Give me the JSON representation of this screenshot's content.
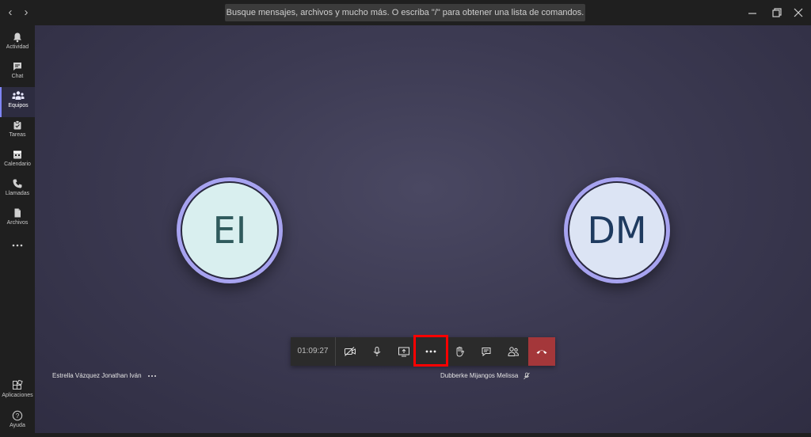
{
  "search": {
    "placeholder": "Busque mensajes, archivos y mucho más. O escriba \"/\" para obtener una lista de comandos."
  },
  "nav": {
    "back": "‹",
    "forward": "›"
  },
  "rail": {
    "items": [
      {
        "label": "Actividad",
        "icon": "bell-icon"
      },
      {
        "label": "Chat",
        "icon": "chat-icon"
      },
      {
        "label": "Equipos",
        "icon": "teams-icon",
        "active": true
      },
      {
        "label": "Tareas",
        "icon": "tasks-icon"
      },
      {
        "label": "Calendario",
        "icon": "calendar-icon"
      },
      {
        "label": "Llamadas",
        "icon": "phone-icon"
      },
      {
        "label": "Archivos",
        "icon": "files-icon"
      },
      {
        "label": "Más",
        "icon": "more-icon"
      }
    ],
    "bottom": [
      {
        "label": "Aplicaciones",
        "icon": "apps-icon"
      },
      {
        "label": "Ayuda",
        "icon": "help-icon"
      }
    ]
  },
  "participants": [
    {
      "initials": "EI",
      "name": "Estrella Vázquez Jonathan Iván",
      "bg": "#d9efef",
      "fg": "#2f5a5c"
    },
    {
      "initials": "DM",
      "name": "Dubberke Mijangos Melissa",
      "bg": "#dce4f4",
      "fg": "#1e3a5f"
    }
  ],
  "controls": {
    "timer": "01:09:27",
    "buttons": [
      "camera-off-icon",
      "mic-icon",
      "share-screen-icon",
      "more-actions-icon",
      "raise-hand-icon",
      "chat-icon",
      "participants-icon",
      "hang-up-icon"
    ]
  },
  "colors": {
    "accent": "#7f85f5",
    "hangup": "#a4373a",
    "highlight": "#ff0000"
  }
}
